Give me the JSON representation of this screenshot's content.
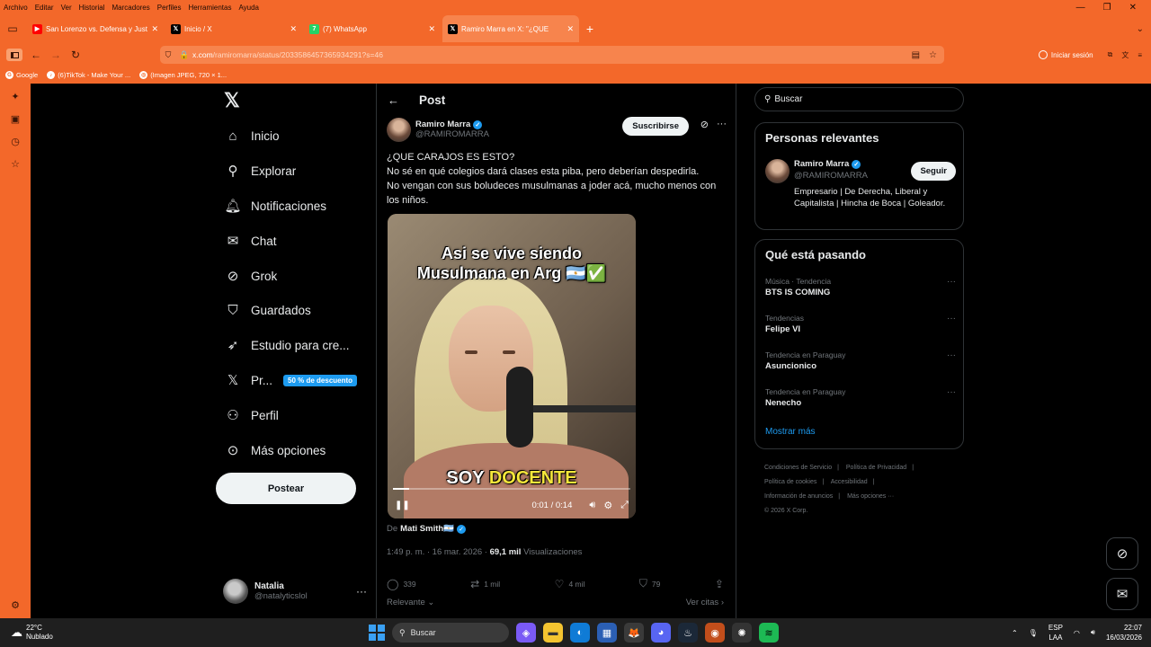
{
  "menubar": {
    "items": [
      "Archivo",
      "Editar",
      "Ver",
      "Historial",
      "Marcadores",
      "Perfiles",
      "Herramientas",
      "Ayuda"
    ]
  },
  "tabs": [
    {
      "title": "San Lorenzo vs. Defensa y Justic",
      "icon": "youtube-icon",
      "color": "#ff0000",
      "glyph": "▶"
    },
    {
      "title": "Inicio / X",
      "icon": "x-icon",
      "color": "#000000",
      "glyph": "𝕏"
    },
    {
      "title": "(7) WhatsApp",
      "icon": "whatsapp-icon",
      "color": "#25d366",
      "glyph": "7"
    },
    {
      "title": "Ramiro Marra en X: \"¿QUE",
      "icon": "x-icon",
      "color": "#000000",
      "glyph": "𝕏"
    }
  ],
  "navbar": {
    "url_host": "x.com",
    "url_path": "/ramiromarra/status/2033586457365934291?s=46",
    "login_label": "Iniciar sesión"
  },
  "bookmarks": [
    {
      "label": "Google",
      "glyph": "G"
    },
    {
      "label": "(6)TikTok - Make Your ...",
      "glyph": "♪"
    },
    {
      "label": "(Imagen JPEG, 720 × 1...",
      "glyph": "◎"
    }
  ],
  "leftnav": {
    "items": [
      {
        "label": "Inicio",
        "icon": "home-icon",
        "glyph": "⌂"
      },
      {
        "label": "Explorar",
        "icon": "search-icon",
        "glyph": "⚲"
      },
      {
        "label": "Notificaciones",
        "icon": "bell-icon",
        "glyph": "🔔"
      },
      {
        "label": "Chat",
        "icon": "mail-icon",
        "glyph": "✉"
      },
      {
        "label": "Grok",
        "icon": "grok-icon",
        "glyph": "⊘"
      },
      {
        "label": "Guardados",
        "icon": "bookmark-icon",
        "glyph": "🔖"
      },
      {
        "label": "Estudio para cre...",
        "icon": "rocket-icon",
        "glyph": "🚀"
      },
      {
        "label": "Pr...",
        "icon": "x-premium-icon",
        "glyph": "𝕏"
      },
      {
        "label": "Perfil",
        "icon": "person-icon",
        "glyph": "👤"
      },
      {
        "label": "Más opciones",
        "icon": "more-circle-icon",
        "glyph": "⋯"
      }
    ],
    "promo_badge": "50 % de descuento",
    "post_button": "Postear",
    "profile": {
      "name": "Natalia",
      "handle": "@natalyticslol"
    }
  },
  "center": {
    "header_title": "Post",
    "author": {
      "name": "Ramiro Marra",
      "handle": "@RAMIROMARRA"
    },
    "subscribe_label": "Suscribirse",
    "text_lines": [
      "¿QUE CARAJOS ES ESTO?",
      "No sé en qué colegios dará clases esta piba, pero deberían despedirla.",
      "No vengan con sus boludeces musulmanas a joder acá, mucho menos con los niños."
    ],
    "video": {
      "caption_top_1": "Asi se vive siendo",
      "caption_top_2": "Musulmana en Arg 🇦🇷✅",
      "caption_bottom_1": "SOY",
      "caption_bottom_2": "DOCENTE",
      "time": "0:01 / 0:14",
      "progress": 0.07
    },
    "via_prefix": "De",
    "via_name": "Mati Smith🇦🇷",
    "meta_time": "1:49 p. m. · 16 mar. 2026 ·",
    "meta_views": "69,1 mil",
    "meta_views_label": "Visualizaciones",
    "actions": [
      {
        "icon": "reply-icon",
        "glyph": "💬",
        "count": "339"
      },
      {
        "icon": "repost-icon",
        "glyph": "⇄",
        "count": "1 mil"
      },
      {
        "icon": "like-icon",
        "glyph": "♡",
        "count": "4 mil"
      },
      {
        "icon": "bookmark-icon",
        "glyph": "🔖",
        "count": "79"
      },
      {
        "icon": "share-icon",
        "glyph": "⇪",
        "count": ""
      }
    ],
    "sort_label": "Relevante",
    "quotes_label": "Ver citas"
  },
  "right": {
    "search_placeholder": "Buscar",
    "relevant_title": "Personas relevantes",
    "relevant_user": {
      "name": "Ramiro Marra",
      "handle": "@RAMIROMARRA",
      "bio": "Empresario | De Derecha, Liberal y Capitalista | Hincha de Boca | Goleador.",
      "follow_label": "Seguir"
    },
    "trending_title": "Qué está pasando",
    "trends": [
      {
        "context": "Música · Tendencia",
        "name": "BTS IS COMING"
      },
      {
        "context": "Tendencias",
        "name": "Felipe VI"
      },
      {
        "context": "Tendencia en Paraguay",
        "name": "Asuncionico"
      },
      {
        "context": "Tendencia en Paraguay",
        "name": "Nenecho"
      }
    ],
    "show_more": "Mostrar más",
    "footer_links": [
      "Condiciones de Servicio",
      "Política de Privacidad",
      "Política de cookies",
      "Accesibilidad",
      "Información de anuncios",
      "Más opciones ···",
      "© 2026 X Corp."
    ]
  },
  "taskbar": {
    "weather_temp": "22°C",
    "weather_desc": "Nublado",
    "search_label": "Buscar",
    "lang_1": "ESP",
    "lang_2": "LAA",
    "time": "22:07",
    "date": "16/03/2026"
  },
  "colors": {
    "browser_orange": "#f3682a",
    "x_blue": "#1d9bf0",
    "docente_yellow": "#f5e63b"
  }
}
